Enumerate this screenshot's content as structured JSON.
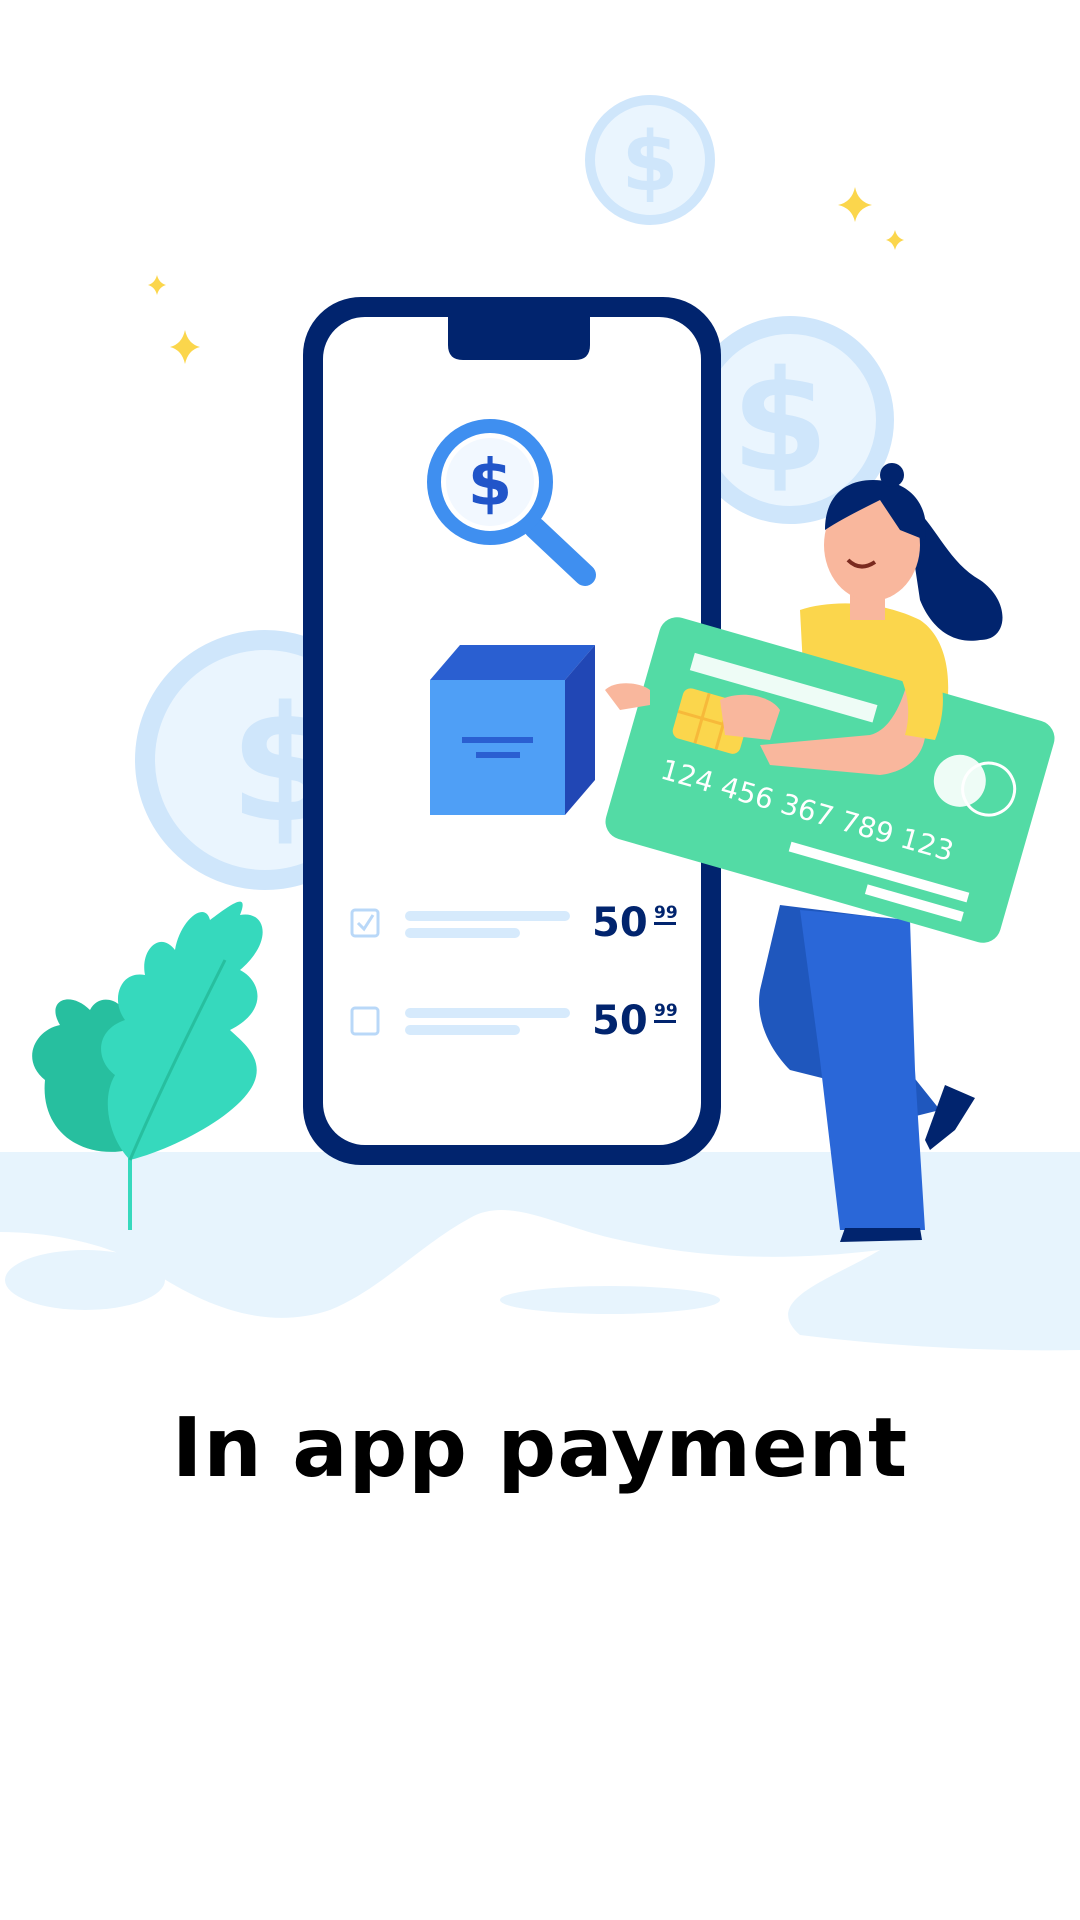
{
  "screen": {
    "title": "In app payment"
  },
  "illustration": {
    "magnifier_symbol": "$",
    "coin_symbol": "$",
    "card_number": "124 456 367 789 123",
    "list_items": [
      {
        "checked": true,
        "price_whole": "50",
        "price_cents": "99"
      },
      {
        "checked": false,
        "price_whole": "50",
        "price_cents": "99"
      }
    ]
  },
  "colors": {
    "phone_frame": "#01246e",
    "accent_blue": "#3f8ff0",
    "box_blue": "#4f9ff6",
    "card_green": "#53dba5",
    "coin_light": "#cfe6fb",
    "leaf_teal": "#36d9bd",
    "ground": "#e7f4fd",
    "sparkle": "#fbd64c",
    "text": "#000000"
  }
}
